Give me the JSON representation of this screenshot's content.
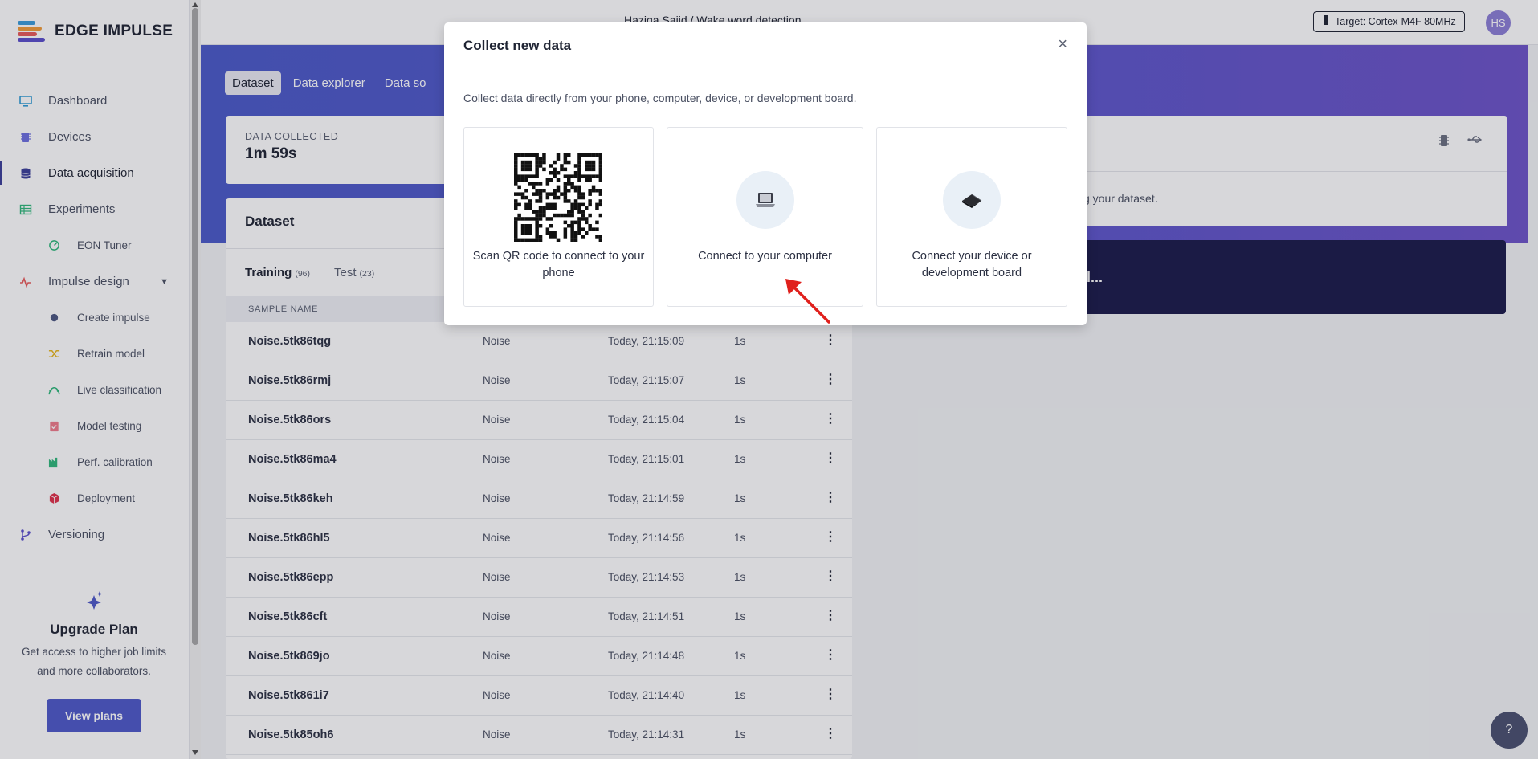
{
  "app": {
    "name": "EDGE IMPULSE"
  },
  "sidebar": {
    "items": [
      {
        "label": "Dashboard",
        "icon": "monitor-icon"
      },
      {
        "label": "Devices",
        "icon": "chip-icon"
      },
      {
        "label": "Data acquisition",
        "icon": "database-icon",
        "active": true
      },
      {
        "label": "Experiments",
        "icon": "table-icon"
      },
      {
        "label": "EON Tuner",
        "icon": "tuner-icon",
        "sub": true
      },
      {
        "label": "Impulse design",
        "icon": "pulse-icon",
        "expandable": true
      },
      {
        "label": "Create impulse",
        "icon": "dot-icon",
        "sub": true
      },
      {
        "label": "Retrain model",
        "icon": "shuffle-icon",
        "sub": true
      },
      {
        "label": "Live classification",
        "icon": "curve-icon",
        "sub": true
      },
      {
        "label": "Model testing",
        "icon": "clipboard-check-icon",
        "sub": true
      },
      {
        "label": "Perf. calibration",
        "icon": "factory-icon",
        "sub": true
      },
      {
        "label": "Deployment",
        "icon": "package-icon",
        "sub": true
      },
      {
        "label": "Versioning",
        "icon": "branch-icon"
      }
    ],
    "upgrade": {
      "title": "Upgrade Plan",
      "text": "Get access to higher job limits and more collaborators.",
      "button": "View plans"
    }
  },
  "topbar": {
    "breadcrumb": "Haziqa Sajid / Wake word detection",
    "target": "Target: Cortex-M4F 80MHz",
    "avatar": "HS"
  },
  "tabs": [
    "Dataset",
    "Data explorer",
    "Data so"
  ],
  "stats": {
    "label": "DATA COLLECTED",
    "value": "1m 59s"
  },
  "dataset": {
    "title": "Dataset",
    "tabs": [
      {
        "label": "Training",
        "count": "(96)"
      },
      {
        "label": "Test",
        "count": "(23)"
      }
    ],
    "column_header": "SAMPLE NAME",
    "rows": [
      {
        "name": "Noise.5tk86tqg",
        "label": "Noise",
        "date": "Today, 21:15:09",
        "length": "1s"
      },
      {
        "name": "Noise.5tk86rmj",
        "label": "Noise",
        "date": "Today, 21:15:07",
        "length": "1s"
      },
      {
        "name": "Noise.5tk86ors",
        "label": "Noise",
        "date": "Today, 21:15:04",
        "length": "1s"
      },
      {
        "name": "Noise.5tk86ma4",
        "label": "Noise",
        "date": "Today, 21:15:01",
        "length": "1s"
      },
      {
        "name": "Noise.5tk86keh",
        "label": "Noise",
        "date": "Today, 21:14:59",
        "length": "1s"
      },
      {
        "name": "Noise.5tk86hl5",
        "label": "Noise",
        "date": "Today, 21:14:56",
        "length": "1s"
      },
      {
        "name": "Noise.5tk86epp",
        "label": "Noise",
        "date": "Today, 21:14:53",
        "length": "1s"
      },
      {
        "name": "Noise.5tk86cft",
        "label": "Noise",
        "date": "Today, 21:14:51",
        "length": "1s"
      },
      {
        "name": "Noise.5tk869jo",
        "label": "Noise",
        "date": "Today, 21:14:48",
        "length": "1s"
      },
      {
        "name": "Noise.5tk861i7",
        "label": "Noise",
        "date": "Today, 21:14:40",
        "length": "1s"
      },
      {
        "name": "Noise.5tk85oh6",
        "label": "Noise",
        "date": "Today, 21:14:31",
        "length": "1s"
      }
    ]
  },
  "right_panel": {
    "text": "g your dataset.",
    "banner": "l..."
  },
  "modal": {
    "title": "Collect new data",
    "close": "×",
    "description": "Collect data directly from your phone, computer, device, or development board.",
    "options": [
      {
        "label": "Scan QR code to connect to your phone",
        "icon": "qr-code-icon"
      },
      {
        "label": "Connect to your computer",
        "icon": "laptop-icon"
      },
      {
        "label": "Connect your device or development board",
        "icon": "device-icon"
      }
    ]
  },
  "help": {
    "label": "?"
  },
  "colors": {
    "brand": "#4e58c9",
    "active_nav": "#3b3f99",
    "dark_banner": "#1a1a4a",
    "arrow": "#e0201c"
  }
}
